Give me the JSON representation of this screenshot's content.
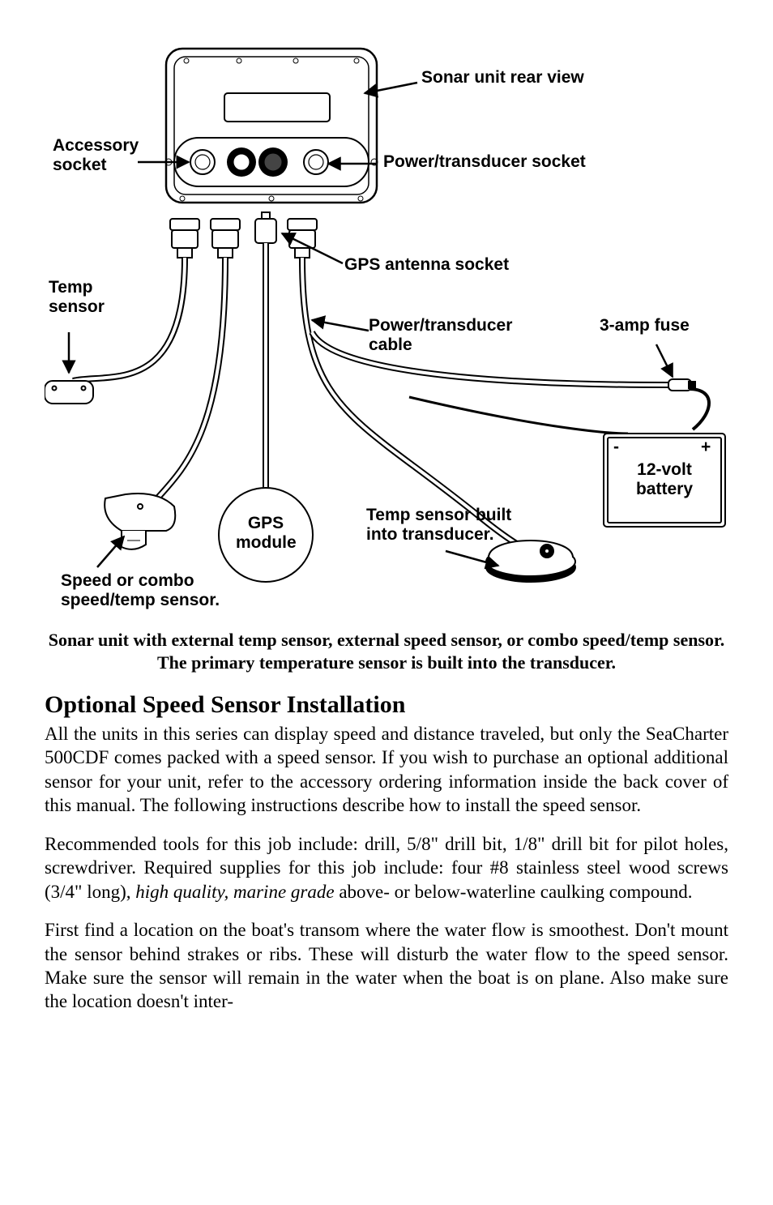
{
  "diagram": {
    "labels": {
      "sonar_rear": "Sonar unit rear view",
      "accessory_socket": "Accessory\nsocket",
      "power_transducer_socket": "Power/transducer socket",
      "gps_antenna_socket": "GPS antenna socket",
      "temp_sensor": "Temp\nsensor",
      "power_transducer_cable": "Power/transducer\ncable",
      "three_amp_fuse": "3-amp fuse",
      "twelve_volt_battery": "12-volt\nbattery",
      "gps_module": "GPS\nmodule",
      "temp_sensor_built": "Temp sensor built\ninto transducer.",
      "speed_combo": "Speed or combo\nspeed/temp sensor.",
      "minus": "-",
      "plus": "+"
    }
  },
  "caption": "Sonar unit with external temp sensor, external speed sensor, or combo speed/temp sensor. The primary temperature sensor is built into the transducer.",
  "section_title": "Optional Speed Sensor Installation",
  "para1_a": "All the units in this series can display speed and distance traveled, but only the SeaCharter 500CDF comes packed with a speed sensor. If you wish to purchase an optional additional sensor for your unit, refer to the accessory ordering information inside the back cover of this manual. The following instructions describe how to install the speed sensor.",
  "para2_a": "Recommended tools for this job include: drill, 5/8\" drill bit, 1/8\" drill bit for pilot holes, screwdriver. Required supplies for this job include: four #8 stainless steel wood screws (3/4\" long), ",
  "para2_italic": "high quality, marine grade",
  "para2_b": " above- or below-waterline caulking compound.",
  "para3": "First find a location on the boat's transom where the water flow is smoothest. Don't mount the sensor behind strakes or ribs. These will disturb the water flow to the speed sensor. Make sure the sensor will remain in the water when the boat is on plane. Also make sure the location doesn't inter-"
}
